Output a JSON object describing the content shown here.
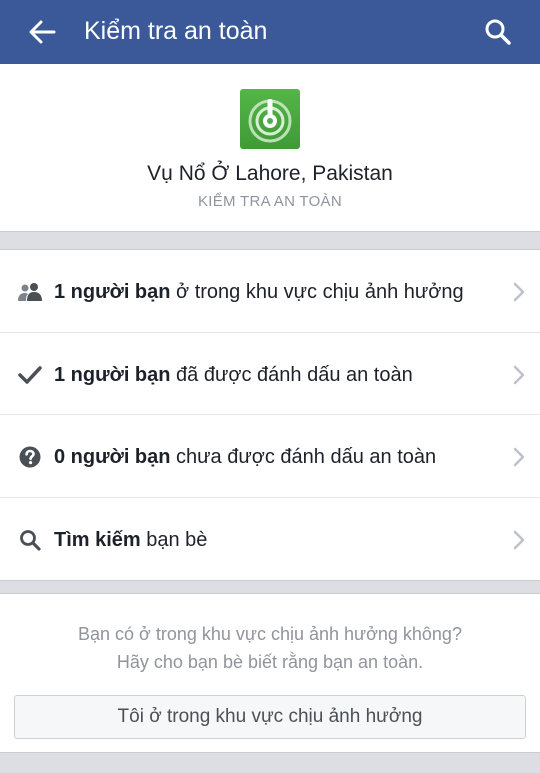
{
  "header": {
    "title": "Kiểm tra an toàn",
    "back_icon": "arrow-left-icon",
    "search_icon": "search-icon",
    "bar_color": "#3b5998"
  },
  "event": {
    "icon": "safety-check-alert-icon",
    "icon_color": "#4caf50",
    "name": "Vụ Nổ Ở Lahore, Pakistan",
    "subtitle": "KIỂM TRA AN TOÀN"
  },
  "rows": [
    {
      "icon": "friends-icon",
      "bold": "1 người bạn",
      "rest": " ở trong khu vực chịu ảnh hưởng"
    },
    {
      "icon": "checkmark-icon",
      "bold": "1 người bạn",
      "rest": " đã được đánh dấu an toàn"
    },
    {
      "icon": "question-icon",
      "bold": "0 người bạn",
      "rest": " chưa được đánh dấu an toàn"
    },
    {
      "icon": "search-icon",
      "bold": "Tìm kiếm",
      "rest": " bạn bè"
    }
  ],
  "prompt": {
    "line1": "Bạn có ở trong khu vực chịu ảnh hưởng không?",
    "line2": "Hãy cho bạn bè biết rằng bạn an toàn.",
    "button_label": "Tôi ở trong khu vực chịu ảnh hưởng"
  }
}
